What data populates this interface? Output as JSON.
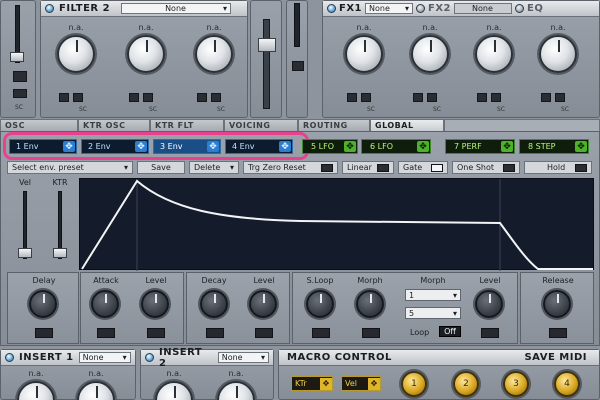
{
  "filter2": {
    "title": "FILTER 2",
    "preset": "None",
    "knob_labels": [
      "n.a.",
      "n.a.",
      "n.a."
    ],
    "sc": [
      "SC",
      "SC",
      "SC"
    ]
  },
  "left_sc": "SC",
  "fx1": {
    "title": "FX1",
    "preset": "None",
    "knob_labels": [
      "n.a.",
      "n.a.",
      "n.a.",
      "n.a."
    ]
  },
  "fx2": {
    "title": "FX2",
    "preset": "None"
  },
  "eq": {
    "title": "EQ"
  },
  "fx_sc": [
    "SC",
    "SC",
    "SC",
    "SC"
  ],
  "tabs": [
    "OSC",
    "KTR OSC",
    "KTR FLT",
    "VOICING",
    "ROUTING",
    "GLOBAL"
  ],
  "env_buttons": [
    "1 Env",
    "2 Env",
    "3 Env",
    "4 Env"
  ],
  "lfo_buttons": [
    "5 LFO",
    "6 LFO",
    "7 PERF",
    "8 STEP"
  ],
  "move_icon": "✥",
  "preset_bar": {
    "select": "Select env. preset",
    "save": "Save",
    "delete": "Delete",
    "trig": "Trg Zero Reset",
    "linear": "Linear",
    "gate": "Gate",
    "one_shot": "One Shot",
    "hold": "Hold"
  },
  "sliders": {
    "vel": "Vel",
    "ktr": "KTR"
  },
  "env_labels": {
    "delay": "Delay",
    "attack": "Attack",
    "level1": "Level",
    "decay": "Decay",
    "level2": "Level",
    "sloop": "S.Loop",
    "morph1": "Morph",
    "morph2": "Morph",
    "level3": "Level",
    "release": "Release",
    "loop": "Loop",
    "off": "Off"
  },
  "morph_dd": [
    "1",
    "5"
  ],
  "insert1": {
    "title": "INSERT 1",
    "preset": "None",
    "knob_labels": [
      "n.a.",
      "n.a."
    ]
  },
  "insert2": {
    "title": "INSERT 2",
    "preset": "None",
    "knob_labels": [
      "n.a.",
      "n.a."
    ]
  },
  "macro": {
    "title": "MACRO CONTROL",
    "save": "SAVE MIDI",
    "ktr": "KTr",
    "vel": "Vel",
    "numbers": [
      "1",
      "2",
      "3",
      "4"
    ]
  },
  "colors": {
    "env_blue": "#2c7fd0",
    "lfo_green": "#4db22a",
    "highlight": "#e8418f",
    "display_bg": "#141b2a"
  }
}
